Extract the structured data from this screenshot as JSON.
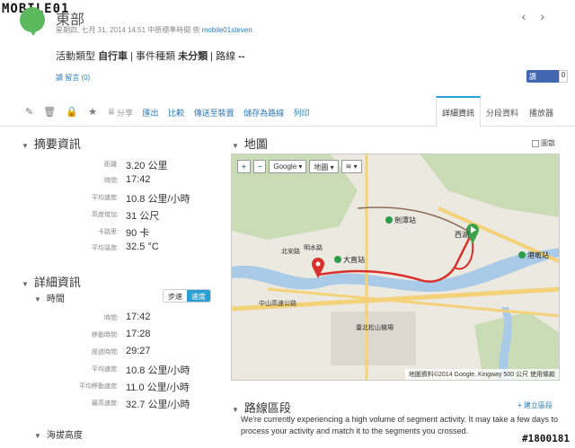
{
  "watermark": {
    "top": "MOBILE01",
    "bottom": "#1800181"
  },
  "header": {
    "title": "東部",
    "meta_prefix": "星期四, 七月 31, 2014 14:51 中原標準時間 依",
    "username": "mobile01steven",
    "prev": "‹",
    "next": "›"
  },
  "activity": {
    "type_label": "活動類型",
    "type_value": "自行車",
    "category_label": "事件種類",
    "category_value": "未分類",
    "route_label": "路線",
    "route_value": "--",
    "comments": "讀 留言 (0)"
  },
  "facebook": {
    "label": "讚",
    "count": "0"
  },
  "toolbar": {
    "icons": [
      "pencil-icon",
      "trash-icon",
      "lock-icon",
      "star-icon",
      "trophy-icon"
    ],
    "share": "分享",
    "export": "匯出",
    "compare": "比較",
    "send_device": "傳送至裝置",
    "save_route": "儲存為路線",
    "print": "列印"
  },
  "tabs": [
    "詳細資訊",
    "分段資料",
    "播放器"
  ],
  "summary": {
    "title": "摘要資訊",
    "rows": [
      {
        "label": "距離:",
        "value": "3.20 公里"
      },
      {
        "label": "時間:",
        "value": "17:42"
      },
      {
        "label": "平均速度:",
        "value": "10.8 公里/小時"
      },
      {
        "label": "高度增加:",
        "value": "31 公尺"
      },
      {
        "label": "卡路里:",
        "value": "90 卡"
      },
      {
        "label": "平均溫度:",
        "value": "32.5 °C"
      }
    ]
  },
  "details": {
    "title": "詳細資訊",
    "time_title": "時間",
    "toggle": {
      "pace": "步速",
      "speed": "速度"
    },
    "rows": [
      {
        "label": "時間:",
        "value": "17:42"
      },
      {
        "label": "移動時間:",
        "value": "17:28"
      },
      {
        "label": "經過時間:",
        "value": "29:27"
      },
      {
        "label": "平均速度:",
        "value": "10.8 公里/小時"
      },
      {
        "label": "平均移動速度:",
        "value": "11.0 公里/小時"
      },
      {
        "label": "最高速度:",
        "value": "32.7 公里/小時"
      }
    ],
    "elevation_title": "海拔高度"
  },
  "map": {
    "title": "地圖",
    "chart_checkbox": "圖散",
    "zoom_in": "+",
    "zoom_out": "−",
    "provider": "Google ▾",
    "map_type": "地圖 ▾",
    "layers": "≋ ▾",
    "attribution": "地圖資料©2014 Google, Kingway",
    "scale": "500 公尺",
    "terms": "使用條款",
    "labels": {
      "station_a": "劍潭站",
      "station_b": "大直站",
      "station_c": "西湖",
      "station_d": "港墘站",
      "taipei_zoo": "北安路",
      "airport": "臺北松山機場",
      "hwy": "中山高速公路",
      "road": "明水路"
    }
  },
  "segments": {
    "title": "路線區段",
    "add": "+ 建立區段",
    "message": "We're currently experiencing a high volume of segment activity. It may take a few days to process your activity and match it to the segments you crossed."
  }
}
